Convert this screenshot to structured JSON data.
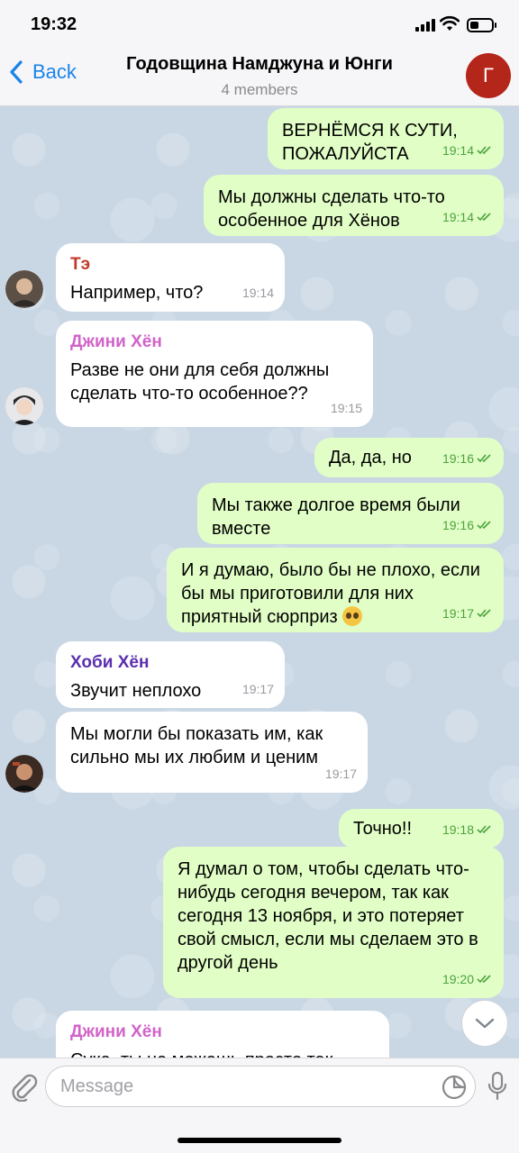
{
  "status_bar": {
    "time": "19:32",
    "battery_percent": 40
  },
  "header": {
    "back_label": "Back",
    "title": "Годовщина Намджуна и Юнги",
    "subtitle": "4 members",
    "avatar_letter": "Г",
    "avatar_color": "#b5261a"
  },
  "messages": [
    {
      "dir": "out",
      "text": "ВЕРНЁМСЯ К СУТИ, ПОЖАЛУЙСТА",
      "time": "19:14",
      "read": true
    },
    {
      "dir": "out",
      "text": "Мы должны сделать что-то особенное для Хёнов",
      "time": "19:14",
      "read": true
    },
    {
      "dir": "in",
      "sender": "Тэ",
      "sender_color": "#c0392b",
      "text": "Например, что?",
      "time": "19:14"
    },
    {
      "dir": "in",
      "sender": "Джини Хён",
      "sender_color": "#d163c9",
      "text": "Разве не они для себя должны сделать что-то особенное??",
      "time": "19:15"
    },
    {
      "dir": "out",
      "text": "Да, да, но",
      "time": "19:16",
      "read": true
    },
    {
      "dir": "out",
      "text": "Мы также долгое время были вместе",
      "time": "19:16",
      "read": true
    },
    {
      "dir": "out",
      "text": "И я думаю, было бы не плохо, если бы мы приготовили для них приятный сюрприз",
      "emoji": "pleading-face",
      "time": "19:17",
      "read": true
    },
    {
      "dir": "in",
      "sender": "Хоби Хён",
      "sender_color": "#5b2fb0",
      "text": "Звучит неплохо",
      "time": "19:17"
    },
    {
      "dir": "in",
      "text": "Мы могли бы показать им, как сильно мы их любим и ценим",
      "time": "19:17"
    },
    {
      "dir": "out",
      "text": "Точно!!",
      "time": "19:18",
      "read": true
    },
    {
      "dir": "out",
      "text": "Я думал о том, чтобы сделать что-нибудь сегодня вечером, так как сегодня 13 ноября, и это потеряет свой смысл, если мы сделаем это в другой день",
      "time": "19:20",
      "read": true
    },
    {
      "dir": "in",
      "sender": "Джини Хён",
      "sender_color": "#d163c9",
      "text": "Сука, ты не можешь просто так"
    }
  ],
  "input": {
    "placeholder": "Message"
  },
  "icons": {
    "back": "chevron-left-icon",
    "attach": "paperclip-icon",
    "sticker": "sticker-icon",
    "mic": "microphone-icon",
    "scroll": "chevron-down-icon"
  },
  "colors": {
    "accent": "#1a83ea",
    "outgoing_bubble": "#e1fec6",
    "read_ticks": "#4ba33e"
  }
}
